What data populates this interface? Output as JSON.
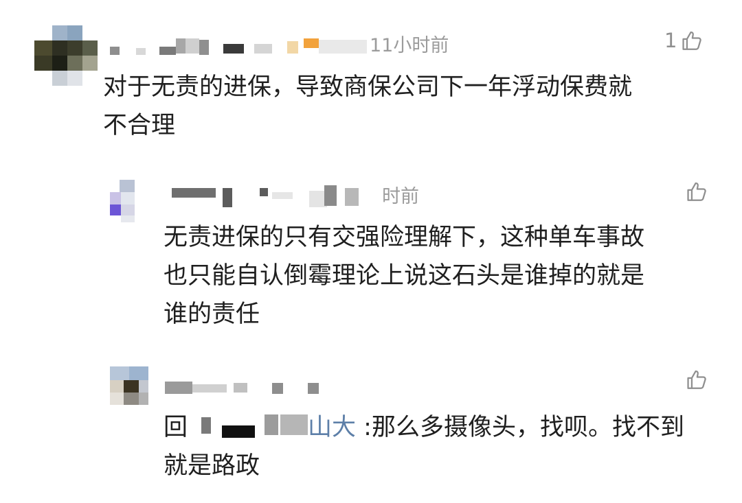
{
  "comments": [
    {
      "meta_text": "11小时前",
      "like_count": "1",
      "body_lines": [
        "对于无责的进保，导致商保公司下一年浮动保费就",
        "不合理"
      ]
    },
    {
      "meta_text": "时前",
      "body_lines": [
        "无责进保的只有交强险理解下，这种单车事故",
        "也只能自认倒霉理论上说这石头是谁掉的就是",
        "谁的责任"
      ]
    },
    {
      "reply_prefix": "回",
      "reply_target_tail": "山大",
      "body_lines": [
        " :那么多摄像头，找呗。找不到",
        "就是路政"
      ]
    }
  ],
  "icons": {
    "like": "thumbs-up-icon",
    "avatar": "avatar"
  },
  "colors": {
    "text": "#1f1f1f",
    "meta": "#9b9b9b",
    "icon": "#8f8f8f",
    "link": "#5d7fa8"
  }
}
